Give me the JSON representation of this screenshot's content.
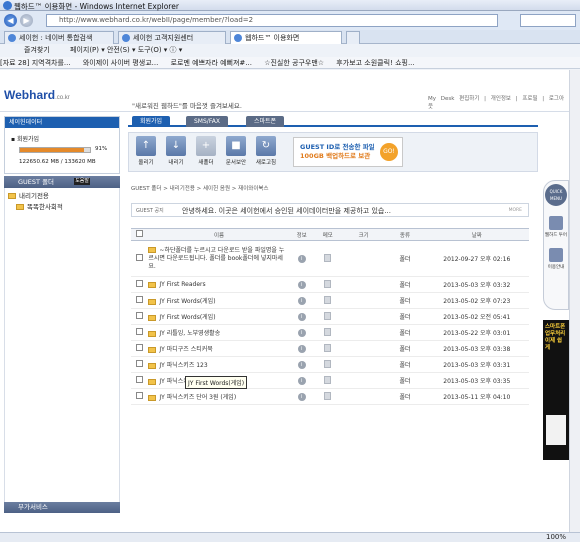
{
  "browser": {
    "title": "웹하드™ 이용화면 - Windows Internet Explorer",
    "url": "http://www.webhard.co.kr/webII/page/member/?load=2",
    "tabs": [
      "세이헌 : 네이버 통합검색",
      "세이헌 고객지원센터",
      "웹하드™ 이용화면"
    ],
    "command_bar": "페이지(P) ▾   안전(S) ▾   도구(O) ▾   ⓘ ▾",
    "favorites": [
      "[자료 28]  지역격차를...",
      "와이제이 사이버 평생교...",
      "로로멘 예쁘자라 예뻐져#...",
      "☆진실한 공구우맨☆",
      "후가보고 소원클릭! 쇼핑..."
    ],
    "zoom": "100%",
    "fav_toolbar": "즐겨찾기"
  },
  "header": {
    "logo": "Webhard",
    "logo_suffix": ".co.kr",
    "message": "\"새로워진 웹하드\"를 마음껏 즐겨보세요.",
    "links": "My Desk 편집하기 | 개인정보 | 프로필 | 로그아웃"
  },
  "sidebar": {
    "box_title": "세이헌데이터",
    "member_label": "회원가입",
    "usage_percent": 91,
    "usage_percent_text": "91%",
    "usage_text": "122650.62 MB / 133620 MB",
    "guest_folder_label": "GUEST 폴더",
    "guest_folder_btn": "도움말",
    "tree": [
      "내리기전용",
      "똑똑한사회적"
    ],
    "bottom_label": "부가서비스"
  },
  "main": {
    "nav_tabs": [
      "회원가입",
      "SMS/FAX",
      "스마트폰"
    ],
    "toolbar_buttons": [
      {
        "label": "올리기",
        "icon": "upload-icon"
      },
      {
        "label": "내리기",
        "icon": "download-icon"
      },
      {
        "label": "새폴더",
        "icon": "new-folder-icon"
      },
      {
        "label": "문서보안",
        "icon": "document-security-icon"
      },
      {
        "label": "새로고침",
        "icon": "refresh-icon"
      }
    ],
    "promo_text1": "GUEST ID로 전송한 파일",
    "promo_text2": "100GB 백업하드로 보관",
    "promo_go": "GO!",
    "breadcrumb": "GUEST 폴더 > 내리기전용 > 세이헌 음원 > 재이와이북스",
    "notice_label": "GUEST 공지",
    "notice_text": "안녕하세요. 이곳은 세이헌에서 승인된 세이데이터만을 제공하고 있습...",
    "notice_more": "MORE",
    "columns": [
      "이름",
      "정보",
      "메모",
      "크기",
      "종류",
      "날짜"
    ],
    "rows": [
      {
        "name": "~하단폴더를 누르시고 다운로드 받을 파일명을 누르시면 다운로드됩니다. 폴더를 book폴더에 넣지마세요.",
        "size": "",
        "type": "폴더",
        "date": "2012-09-27 오후 02:16"
      },
      {
        "name": "JY First Readers",
        "size": "",
        "type": "폴더",
        "date": "2013-05-03 오후 03:32"
      },
      {
        "name": "JY First Words(게임)",
        "size": "",
        "type": "폴더",
        "date": "2013-05-02 오후 07:23"
      },
      {
        "name": "JY First Words(게임)",
        "size": "",
        "type": "폴더",
        "date": "2013-05-02 오전 05:41"
      },
      {
        "name": "JY 리틀잉, 노부영생활송",
        "size": "",
        "type": "폴더",
        "date": "2013-05-22 오후 03:01"
      },
      {
        "name": "JY 마디구즈 스티커북",
        "size": "",
        "type": "폴더",
        "date": "2013-05-03 오후 03:38"
      },
      {
        "name": "JY 파닉스키즈 123",
        "size": "",
        "type": "폴더",
        "date": "2013-05-03 오후 03:31"
      },
      {
        "name": "JY 파닉스키즈 456",
        "size": "",
        "type": "폴더",
        "date": "2013-05-03 오후 03:35"
      },
      {
        "name": "JY 파닉스키즈 단어 3원 (게임)",
        "size": "",
        "type": "폴더",
        "date": "2013-05-11 오후 04:10"
      }
    ],
    "tooltip": "JY First Words(게임)"
  },
  "right_rail": {
    "quick_title": "QUICK MENU",
    "items": [
      "웹하드 투어",
      "이용안내"
    ],
    "ad_text": "스마트폰 업무처리 이제 쉽게"
  }
}
